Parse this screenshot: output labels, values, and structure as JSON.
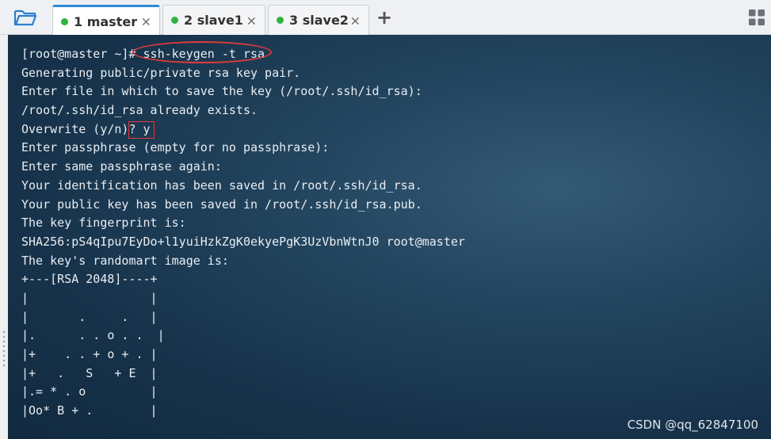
{
  "toolbar": {
    "folder_icon": "folder-open-icon",
    "add_tab_label": "+",
    "layout_icon": "grid-icon"
  },
  "tabs": [
    {
      "label": "1 master",
      "status_color": "#2db340",
      "active": true,
      "close_label": "×"
    },
    {
      "label": "2 slave1",
      "status_color": "#2db340",
      "active": false,
      "close_label": "×"
    },
    {
      "label": "3 slave2",
      "status_color": "#2db340",
      "active": false,
      "close_label": "×"
    }
  ],
  "terminal": {
    "lines": [
      "[root@master ~]# ssh-keygen -t rsa",
      "Generating public/private rsa key pair.",
      "Enter file in which to save the key (/root/.ssh/id_rsa):",
      "/root/.ssh/id_rsa already exists.",
      "Overwrite (y/n)? y",
      "Enter passphrase (empty for no passphrase):",
      "Enter same passphrase again:",
      "Your identification has been saved in /root/.ssh/id_rsa.",
      "Your public key has been saved in /root/.ssh/id_rsa.pub.",
      "The key fingerprint is:",
      "SHA256:pS4qIpu7EyDo+l1yuiHzkZgK0ekyePgK3UzVbnWtnJ0 root@master",
      "The key's randomart image is:",
      "+---[RSA 2048]----+",
      "|                 |",
      "|       .     .   |",
      "|.      . . o . .  |",
      "|+    . . + o + . |",
      "|+   .   S   + E  |",
      "|.= * . o         |",
      "|Oo* B + .        |"
    ]
  },
  "annotations": {
    "highlight_color": "#e23b3b"
  },
  "watermark": "CSDN @qq_62847100"
}
